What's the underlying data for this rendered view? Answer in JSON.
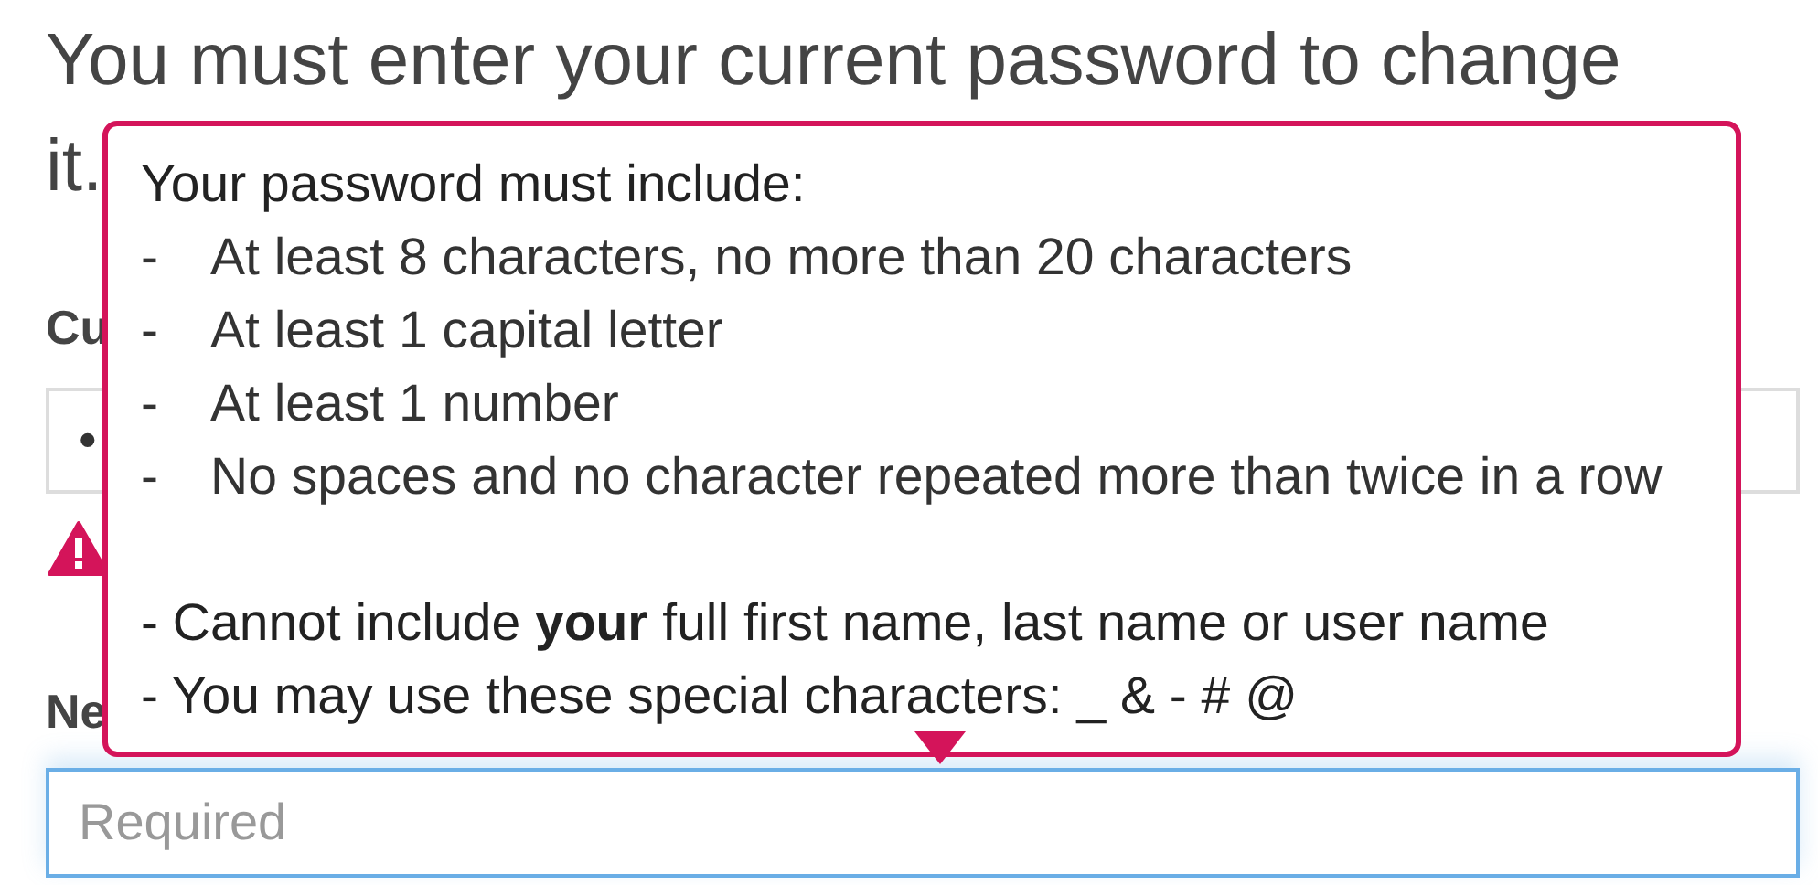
{
  "heading_lines": [
    "You must enter your current password to change",
    "it."
  ],
  "current_password": {
    "label": "Cu",
    "value": "•",
    "error": true
  },
  "new_password": {
    "label": "Ne",
    "placeholder": "Required",
    "focused": true
  },
  "tooltip": {
    "title": "Your password must include:",
    "rules": [
      {
        "marker": "-",
        "text": "At least 8 characters, no more than 20 characters"
      },
      {
        "marker": "-",
        "text": "At least 1 capital letter"
      },
      {
        "marker": "-",
        "text": "At least 1 number"
      },
      {
        "marker": "-",
        "text": "No spaces and no character repeated more than twice in a row"
      }
    ],
    "notes": [
      "- Cannot include **your** full first name, last name or user name",
      "- You may use these special characters: _ & - # @"
    ]
  }
}
